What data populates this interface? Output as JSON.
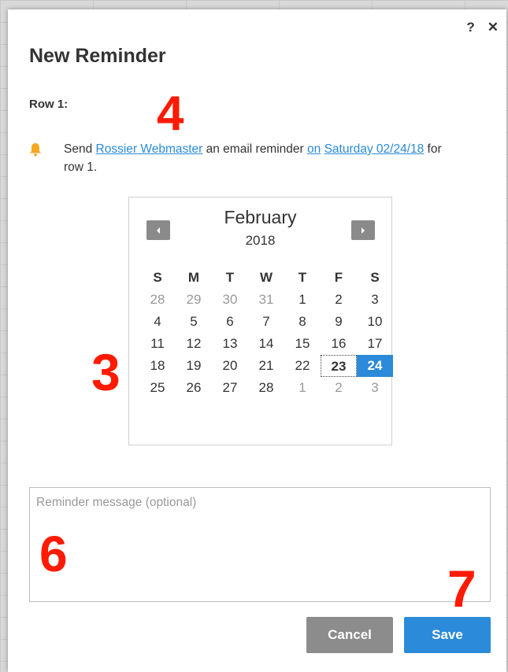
{
  "header": {
    "help_icon": "question-icon",
    "close_icon": "close-icon",
    "help_glyph": "?",
    "close_glyph": "✕"
  },
  "dialog": {
    "title": "New Reminder",
    "row_label": "Row 1:"
  },
  "sentence": {
    "bell_icon": "bell-icon",
    "part1": "Send ",
    "recipient": "Rossier Webmaster",
    "part2": " an email reminder ",
    "on_link": "on",
    "space": " ",
    "date_link": "Saturday 02/24/18",
    "part3": " for row 1."
  },
  "calendar": {
    "month": "February",
    "year": "2018",
    "weekday_headers": [
      "S",
      "M",
      "T",
      "W",
      "T",
      "F",
      "S"
    ],
    "weeks": [
      [
        {
          "d": "28",
          "m": true
        },
        {
          "d": "29",
          "m": true
        },
        {
          "d": "30",
          "m": true
        },
        {
          "d": "31",
          "m": true
        },
        {
          "d": "1"
        },
        {
          "d": "2"
        },
        {
          "d": "3"
        }
      ],
      [
        {
          "d": "4"
        },
        {
          "d": "5"
        },
        {
          "d": "6"
        },
        {
          "d": "7"
        },
        {
          "d": "8"
        },
        {
          "d": "9"
        },
        {
          "d": "10"
        }
      ],
      [
        {
          "d": "11"
        },
        {
          "d": "12"
        },
        {
          "d": "13"
        },
        {
          "d": "14"
        },
        {
          "d": "15"
        },
        {
          "d": "16"
        },
        {
          "d": "17"
        }
      ],
      [
        {
          "d": "18"
        },
        {
          "d": "19"
        },
        {
          "d": "20"
        },
        {
          "d": "21"
        },
        {
          "d": "22"
        },
        {
          "d": "23",
          "today": true
        },
        {
          "d": "24",
          "selected": true
        }
      ],
      [
        {
          "d": "25"
        },
        {
          "d": "26"
        },
        {
          "d": "27"
        },
        {
          "d": "28"
        },
        {
          "d": "1",
          "m": true
        },
        {
          "d": "2",
          "m": true
        },
        {
          "d": "3",
          "m": true
        }
      ]
    ],
    "prev_icon": "chevron-left-icon",
    "next_icon": "chevron-right-icon"
  },
  "message": {
    "placeholder": "Reminder message (optional)",
    "value": ""
  },
  "buttons": {
    "cancel": "Cancel",
    "save": "Save"
  },
  "annotations": {
    "a3": "3",
    "a4": "4",
    "a6": "6",
    "a7": "7"
  },
  "colors": {
    "accent": "#2b8ad9",
    "muted_button": "#8c8c8c",
    "annotation": "#ff1a00",
    "bell": "#f5a623"
  }
}
